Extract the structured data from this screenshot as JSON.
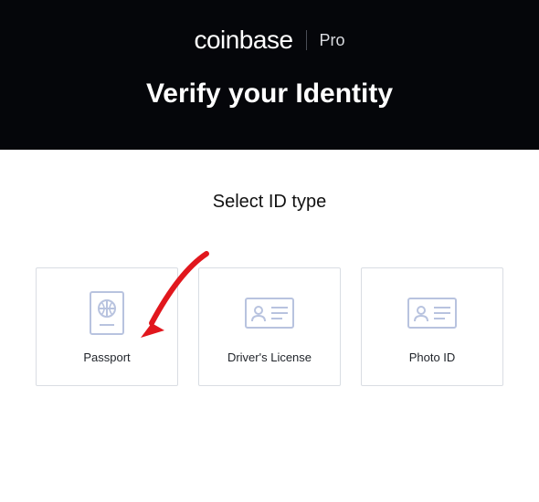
{
  "brand": {
    "main": "coinbase",
    "sub": "Pro"
  },
  "header": {
    "title": "Verify your Identity"
  },
  "section": {
    "title": "Select ID type"
  },
  "options": [
    {
      "id": "passport",
      "label": "Passport",
      "icon": "passport-icon"
    },
    {
      "id": "drivers-license",
      "label": "Driver's License",
      "icon": "id-card-icon"
    },
    {
      "id": "photo-id",
      "label": "Photo ID",
      "icon": "id-card-icon"
    }
  ],
  "annotation": {
    "arrow_target": "passport"
  },
  "colors": {
    "header_bg": "#05060a",
    "icon_stroke": "#b8c3df",
    "arrow": "#e1171d"
  }
}
